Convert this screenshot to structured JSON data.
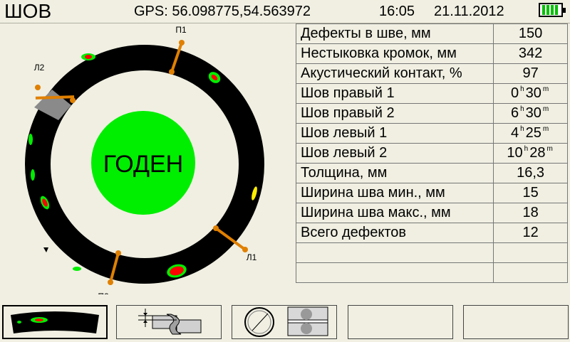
{
  "header": {
    "title": "ШОВ",
    "gps": "GPS: 56.098775,54.563972",
    "time": "16:05",
    "date": "21.11.2012",
    "battery_level": 1.0
  },
  "weld_view": {
    "status": "ГОДЕН",
    "status_color": "#00ee00",
    "markers": {
      "p1": "П1",
      "p2": "П2",
      "l1": "Л1",
      "l2": "Л2"
    },
    "marker_color": "#e08000",
    "defect_color": "#ff0000",
    "contact_color": "#00ee00"
  },
  "params": [
    {
      "label": "Дефекты в шве, мм",
      "value": "150"
    },
    {
      "label": "Нестыковка кромок, мм",
      "value": "342"
    },
    {
      "label": "Акустический контакт, %",
      "value": "97"
    },
    {
      "label": "Шов правый  1",
      "h": "0",
      "m": "30"
    },
    {
      "label": "Шов правый  2",
      "h": "6",
      "m": "30"
    },
    {
      "label": "Шов левый  1",
      "h": "4",
      "m": "25"
    },
    {
      "label": "Шов левый  2",
      "h": "10",
      "m": "28"
    },
    {
      "label": "Толщина, мм",
      "value": "16,3"
    },
    {
      "label": "Ширина шва мин., мм",
      "value": "15"
    },
    {
      "label": "Ширина шва макс., мм",
      "value": "18"
    },
    {
      "label": "Всего дефектов",
      "value": "12"
    },
    {
      "label": "",
      "value": ""
    },
    {
      "label": "",
      "value": ""
    }
  ],
  "units": {
    "h": "h",
    "m": "m"
  },
  "toolbar": [
    {
      "icon": "weld-segment-icon"
    },
    {
      "icon": "edge-misalignment-icon"
    },
    {
      "icon": "pipe-scan-icon"
    },
    {
      "icon": ""
    },
    {
      "icon": ""
    }
  ]
}
